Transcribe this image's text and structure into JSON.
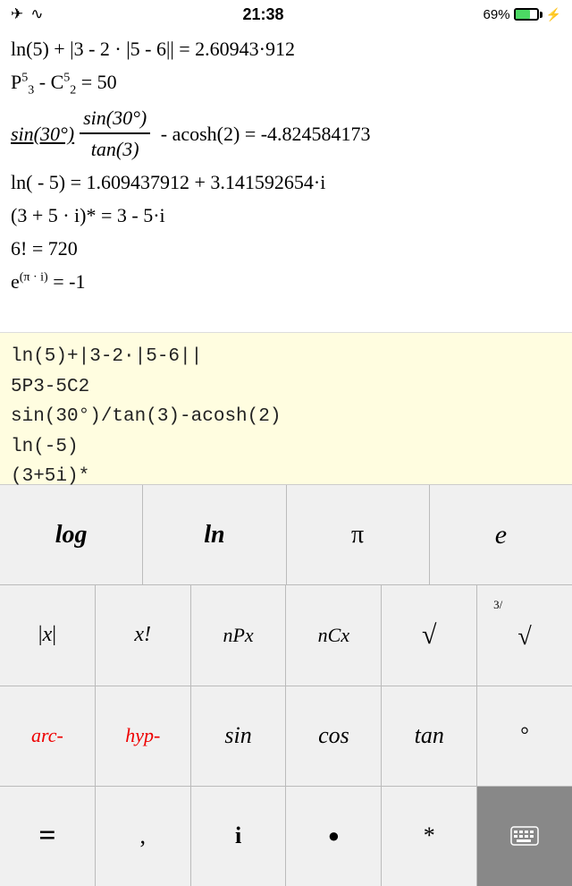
{
  "statusBar": {
    "left": "✈ ☁",
    "time": "21:38",
    "battery": "69%",
    "planeIcon": "✈",
    "wifiIcon": "☁"
  },
  "results": [
    {
      "id": "r1",
      "html": "ln(5) + |3 - 2 · |5 - 6|| = 2.60943·912"
    },
    {
      "id": "r2",
      "html": "P<sup>5</sup><sub>3</sub> - C<sup>5</sup><sub>2</sub> = 50"
    },
    {
      "id": "r3",
      "html": "FRACTION: sin(30°)/tan(3) - acosh(2) = -4.824584173"
    },
    {
      "id": "r4",
      "html": "ln( - 5) = 1.609437912 + 3.141592654·i"
    },
    {
      "id": "r5",
      "html": "(3 + 5 · i)* = 3 - 5·i"
    },
    {
      "id": "r6",
      "html": "6! = 720"
    },
    {
      "id": "r7",
      "html": "e<sup>(π · i)</sup> = -1"
    }
  ],
  "inputs": [
    "ln(5)+|3-2·|5-6||",
    "5P3-5C2",
    "sin(30°)/tan(3)-acosh(2)",
    "ln(-5)",
    "(3+5i)*"
  ],
  "keyRows": [
    {
      "id": "row1",
      "keys": [
        {
          "id": "k-log",
          "label": "log",
          "style": "script bold"
        },
        {
          "id": "k-ln",
          "label": "ln",
          "style": "script bold"
        },
        {
          "id": "k-pi",
          "label": "π",
          "style": "normal"
        },
        {
          "id": "k-e",
          "label": "e",
          "style": "script"
        }
      ]
    },
    {
      "id": "row2",
      "keys": [
        {
          "id": "k-abs",
          "label": "|x|",
          "style": "normal"
        },
        {
          "id": "k-fact",
          "label": "x!",
          "style": "italic"
        },
        {
          "id": "k-npx",
          "label": "nPx",
          "style": "italic"
        },
        {
          "id": "k-ncx",
          "label": "nCx",
          "style": "italic"
        },
        {
          "id": "k-sqrt",
          "label": "√",
          "style": "normal"
        },
        {
          "id": "k-cbrt",
          "label": "∛",
          "style": "normal",
          "superLabel": "3/"
        }
      ]
    },
    {
      "id": "row3",
      "keys": [
        {
          "id": "k-arc",
          "label": "arc-",
          "style": "red italic"
        },
        {
          "id": "k-hyp",
          "label": "hyp-",
          "style": "red italic"
        },
        {
          "id": "k-sin",
          "label": "sin",
          "style": "script"
        },
        {
          "id": "k-cos",
          "label": "cos",
          "style": "script"
        },
        {
          "id": "k-tan",
          "label": "tan",
          "style": "script"
        },
        {
          "id": "k-deg",
          "label": "°",
          "style": "normal"
        }
      ]
    },
    {
      "id": "row4",
      "keys": [
        {
          "id": "k-equals",
          "label": "=",
          "style": "bold large"
        },
        {
          "id": "k-comma",
          "label": ",",
          "style": "normal"
        },
        {
          "id": "k-imag",
          "label": "i",
          "style": "bold"
        },
        {
          "id": "k-dot",
          "label": "•",
          "style": "normal"
        },
        {
          "id": "k-star",
          "label": "*",
          "style": "normal"
        },
        {
          "id": "k-keyboard",
          "label": "⌨",
          "style": "dark"
        }
      ]
    }
  ]
}
